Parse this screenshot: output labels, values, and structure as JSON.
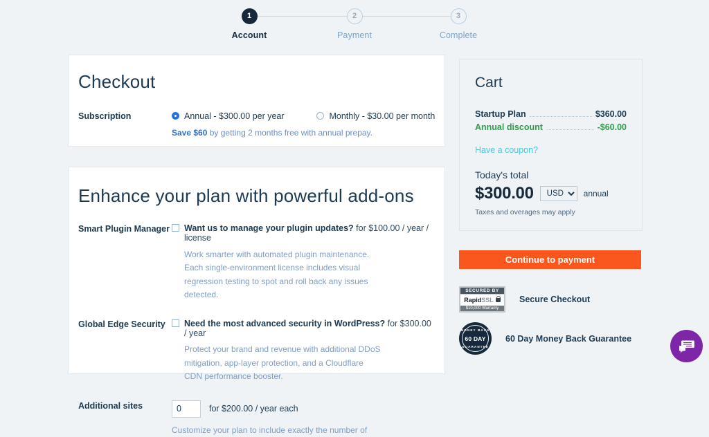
{
  "stepper": {
    "steps": [
      {
        "number": "1",
        "label": "Account",
        "state": "active"
      },
      {
        "number": "2",
        "label": "Payment",
        "state": "inactive"
      },
      {
        "number": "3",
        "label": "Complete",
        "state": "inactive"
      }
    ]
  },
  "checkout": {
    "title": "Checkout",
    "subscription_label": "Subscription",
    "options": [
      {
        "label": "Annual - $300.00 per year",
        "selected": true
      },
      {
        "label": "Monthly - $30.00 per month",
        "selected": false
      }
    ],
    "save_note_bold": "Save $60",
    "save_note_rest": " by getting 2 months free with annual prepay."
  },
  "addons": {
    "title": "Enhance your plan with powerful add-ons",
    "items": [
      {
        "label": "Smart Plugin Manager",
        "question": "Want us to manage your plugin updates?",
        "price": " for $100.00 / year / license",
        "description": "Work smarter with automated plugin maintenance. Each single-environment license includes visual regression testing to spot and roll back any issues detected."
      },
      {
        "label": "Global Edge Security",
        "question": "Need the most advanced security in WordPress?",
        "price": " for $300.00 / year",
        "description": "Protect your brand and revenue with additional DDoS mitigation, app-layer protection, and a Cloudflare CDN performance booster."
      }
    ],
    "additional_sites": {
      "label": "Additional sites",
      "value": "0",
      "price": "for $200.00 / year each",
      "description": "Customize your plan to include exactly the number of"
    }
  },
  "cart": {
    "title": "Cart",
    "lines": [
      {
        "name": "Startup Plan",
        "amount": "$360.00",
        "type": "plan"
      },
      {
        "name": "Annual discount",
        "amount": "-$60.00",
        "type": "discount"
      }
    ],
    "coupon_link": "Have a coupon?",
    "total_label": "Today's total",
    "total_amount": "$300.00",
    "currency": "USD",
    "currency_options": [
      "USD"
    ],
    "period": "annual",
    "taxes_note": "Taxes and overages may apply"
  },
  "cta": {
    "label": "Continue to payment"
  },
  "badges": {
    "ssl": {
      "top_text": "SECURED BY",
      "brand_bold": "Rapid",
      "brand_light": "SSL",
      "warranty": "$10,000 Warranty",
      "caption": "Secure Checkout"
    },
    "money_back": {
      "arc_top": "MONEY BACK",
      "core": "60 DAY",
      "arc_bottom": "GUARANTEE",
      "caption": "60 Day Money Back Guarantee"
    }
  },
  "chat": {
    "icon": "chat-bubble-icon"
  },
  "colors": {
    "page_bg": "#eff3f6",
    "accent_orange": "#fa571e",
    "link_cyan": "#46c8dd",
    "discount_green": "#2e9e4f",
    "radio_blue": "#2472e0",
    "navy": "#16293c",
    "chat_purple": "#7d26a8"
  }
}
